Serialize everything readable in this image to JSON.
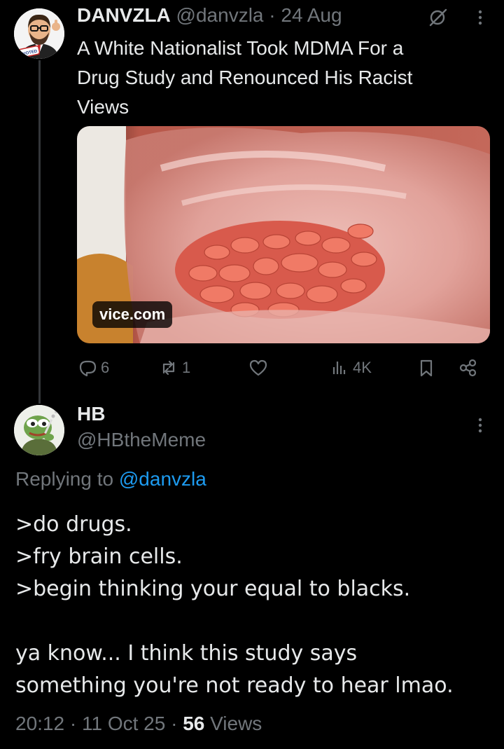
{
  "tweet1": {
    "name": "DANVZLA",
    "handle": "@danvzla",
    "sep": "·",
    "date": "24 Aug",
    "text_lines": [
      "A White Nationalist Took MDMA For a",
      "Drug Study and Renounced His Racist",
      "Views"
    ],
    "card_source": "vice.com",
    "replies": "6",
    "reposts": "1",
    "views": "4K",
    "avatar_badge": "I VOTED"
  },
  "tweet2": {
    "name": "HB",
    "handle": "@HBtheMeme",
    "replying_prefix": "Replying to",
    "replying_handle": "@danvzla",
    "body_lines": [
      ">do drugs.",
      ">fry brain cells.",
      ">begin thinking your equal to blacks."
    ],
    "body_lines_2": [
      "ya know... I think this study says",
      "something you're not ready to hear lmao."
    ],
    "time": "20:12",
    "sep": "·",
    "date": "11 Oct 25",
    "views_count": "56",
    "views_label": "Views"
  },
  "icons": {
    "grok": "grok-icon",
    "more": "more-icon",
    "reply": "reply-icon",
    "repost": "repost-icon",
    "like": "heart-icon",
    "views": "views-bar-chart-icon",
    "bookmark": "bookmark-icon",
    "share": "share-icon"
  },
  "colors": {
    "background": "#000000",
    "text": "#e7e9ea",
    "muted": "#71767b",
    "link": "#1d9bf0"
  }
}
